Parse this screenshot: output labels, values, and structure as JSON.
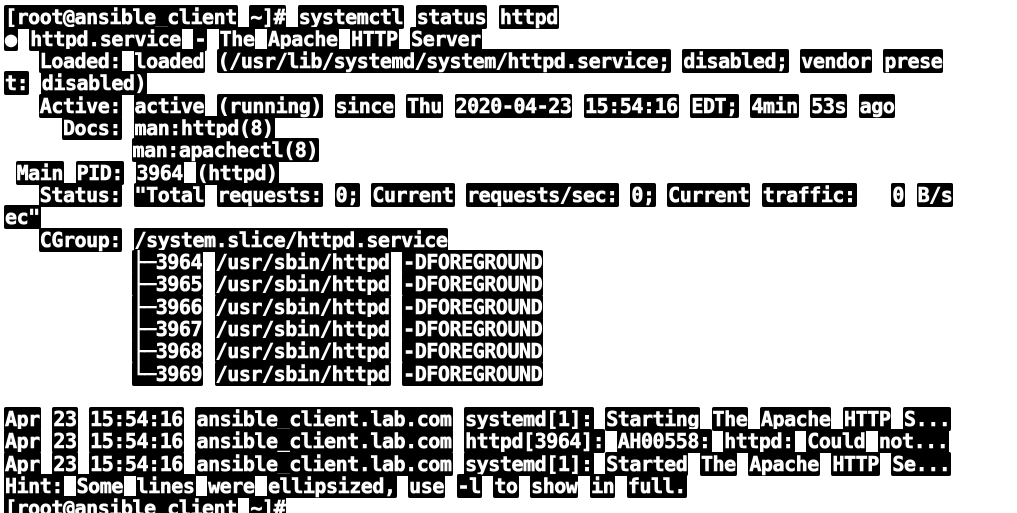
{
  "terminal": {
    "lines": [
      "[root@ansible_client ~]# systemctl status httpd",
      "● httpd.service - The Apache HTTP Server",
      "   Loaded: loaded (/usr/lib/systemd/system/httpd.service; disabled; vendor prese",
      "t: disabled)",
      "   Active: active (running) since Thu 2020-04-23 15:54:16 EDT; 4min 53s ago",
      "     Docs: man:httpd(8)",
      "           man:apachectl(8)",
      " Main PID: 3964 (httpd)",
      "   Status: \"Total requests: 0; Current requests/sec: 0; Current traffic:   0 B/s",
      "ec\"",
      "   CGroup: /system.slice/httpd.service",
      "           ├─3964 /usr/sbin/httpd -DFOREGROUND",
      "           ├─3965 /usr/sbin/httpd -DFOREGROUND",
      "           ├─3966 /usr/sbin/httpd -DFOREGROUND",
      "           ├─3967 /usr/sbin/httpd -DFOREGROUND",
      "           ├─3968 /usr/sbin/httpd -DFOREGROUND",
      "           └─3969 /usr/sbin/httpd -DFOREGROUND",
      "",
      "Apr 23 15:54:16 ansible_client.lab.com systemd[1]: Starting The Apache HTTP S...",
      "Apr 23 15:54:16 ansible_client.lab.com httpd[3964]: AH00558: httpd: Could not...",
      "Apr 23 15:54:16 ansible_client.lab.com systemd[1]: Started The Apache HTTP Se...",
      "Hint: Some lines were ellipsized, use -l to show in full.",
      "[root@ansible_client ~]#"
    ]
  }
}
